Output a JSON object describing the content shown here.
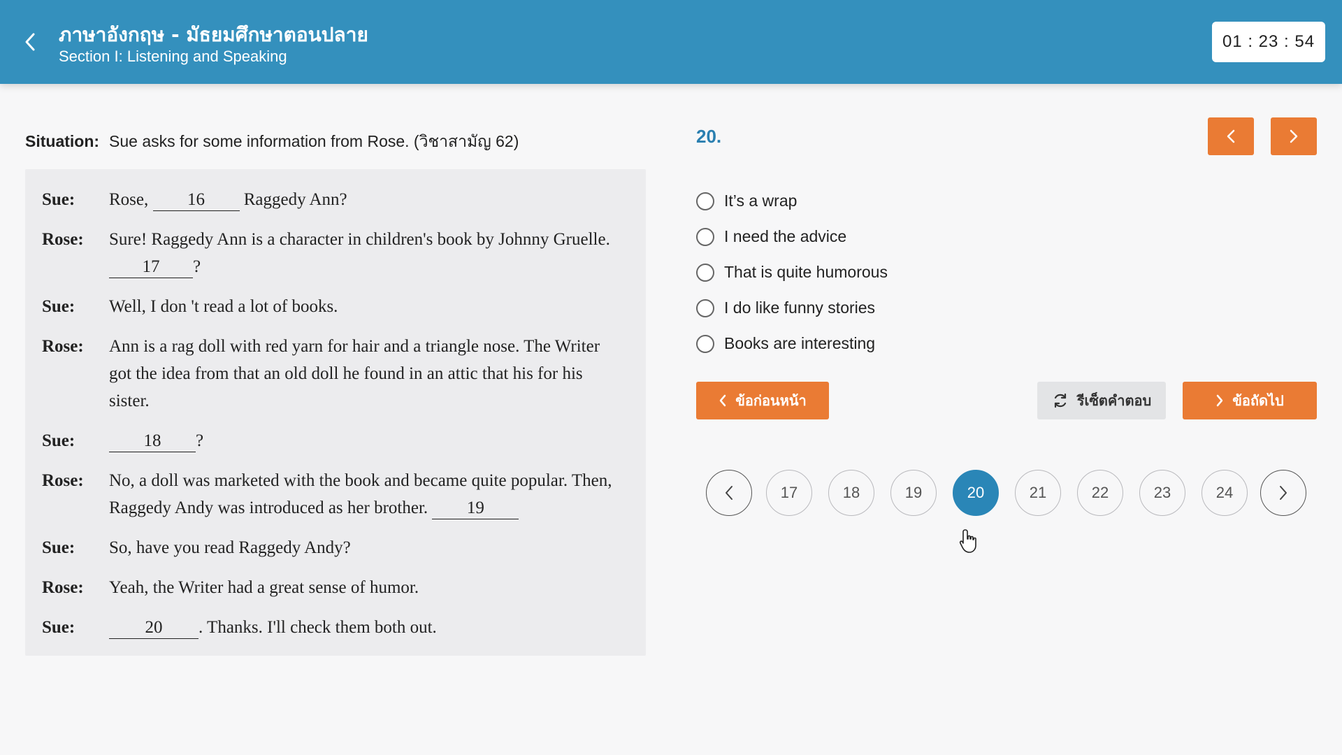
{
  "header": {
    "title": "ภาษาอังกฤษ - มัธยมศึกษาตอนปลาย",
    "subtitle": "Section I: Listening and Speaking",
    "timer": "01 : 23 : 54"
  },
  "situation": {
    "label": "Situation:",
    "text": "Sue asks for some information from Rose. (วิชาสามัญ 62)"
  },
  "dialog": {
    "l1": {
      "speaker": "Sue:",
      "pre": "Rose, ",
      "blank": "16",
      "post": " Raggedy Ann?"
    },
    "l2": {
      "speaker": "Rose:",
      "pre": "Sure! Raggedy Ann is a character in children's book by Johnny Gruelle. ",
      "blank": "17",
      "post": "?"
    },
    "l3": {
      "speaker": "Sue:",
      "pre": "Well, I don 't read a lot of books."
    },
    "l4": {
      "speaker": "Rose:",
      "pre": "Ann is a rag doll with red yarn for hair and a triangle nose. The Writer got the idea from that an old doll he found in an attic that his for his sister."
    },
    "l5": {
      "speaker": "Sue:",
      "blank": "18",
      "post": "?"
    },
    "l6": {
      "speaker": "Rose:",
      "pre": "No, a doll was marketed with the book and became quite popular. Then, Raggedy Andy was introduced as her brother. ",
      "blank": "19"
    },
    "l7": {
      "speaker": "Sue:",
      "pre": "So, have you read Raggedy Andy?"
    },
    "l8": {
      "speaker": "Rose:",
      "pre": "Yeah, the Writer had a great sense of humor."
    },
    "l9": {
      "speaker": "Sue:",
      "blank": "20",
      "post": ". Thanks. I'll check them both out."
    }
  },
  "question": {
    "number": "20.",
    "options": [
      "It’s a wrap",
      "I need the advice",
      "That is quite humorous",
      "I do like funny stories",
      "Books are interesting"
    ]
  },
  "buttons": {
    "prev": "ข้อก่อนหน้า",
    "reset": "รีเซ็ตคำตอบ",
    "next": "ข้อถัดไป"
  },
  "pager": {
    "pages": [
      "17",
      "18",
      "19",
      "20",
      "21",
      "22",
      "23",
      "24"
    ],
    "active": "20"
  },
  "colors": {
    "header": "#3490bd",
    "accent_orange": "#ea7b34",
    "active_page": "#2a86b7",
    "question_number": "#2a7fb0"
  }
}
